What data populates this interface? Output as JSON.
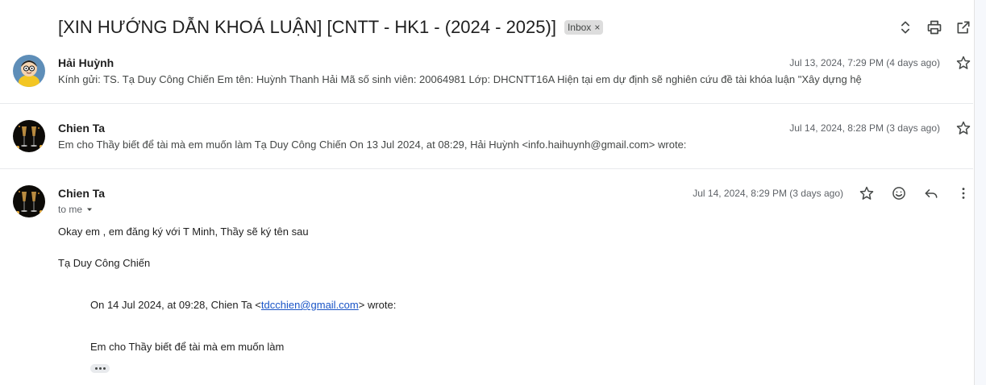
{
  "thread": {
    "subject": "[XIN HƯỚNG DẪN KHOÁ LUẬN] [CNTT - HK1 - (2024 - 2025)]",
    "label": "Inbox",
    "label_remove": "×"
  },
  "header_actions": {
    "expand_icon": "unfold-icon",
    "print_icon": "print-icon",
    "popout_icon": "open-in-new-window-icon"
  },
  "messages": [
    {
      "sender": "Hải Huỳnh",
      "date": "Jul 13, 2024, 7:29 PM (4 days ago)",
      "snippet": "Kính gửi: TS. Tạ Duy Công Chiến Em tên: Huỳnh Thanh Hải Mã số sinh viên: 20064981 Lớp: DHCNTT16A Hiện tại em dự định sẽ nghiên cứu đề tài khóa luận \"Xây dựng hệ",
      "avatar": "cartoon-avatar"
    },
    {
      "sender": "Chien Ta",
      "date": "Jul 14, 2024, 8:28 PM (3 days ago)",
      "snippet": "Em cho Thầy biết để tài mà em muốn làm Tạ Duy Công Chiến On 13 Jul 2024, at 08:29, Hải Huỳnh <info.haihuynh@gmail.com> wrote:",
      "avatar": "champagne-avatar"
    },
    {
      "sender": "Chien Ta",
      "date": "Jul 14, 2024, 8:29 PM (3 days ago)",
      "to": "to me",
      "avatar": "champagne-avatar",
      "body_line1": "Okay em , em đăng ký với T Minh, Thầy sẽ ký tên sau",
      "signature": "Tạ Duy Công Chiến",
      "quote_header_prefix": "On 14 Jul 2024, at 09:28, Chien Ta <",
      "quote_email": "tdcchien@gmail.com",
      "quote_header_suffix": "> wrote:",
      "quote_body": "Em cho Thầy biết để tài mà em muốn làm"
    }
  ],
  "colors": {
    "link": "#1a55c7",
    "chip_bg": "#dddddd",
    "divider": "#e8eaed"
  }
}
